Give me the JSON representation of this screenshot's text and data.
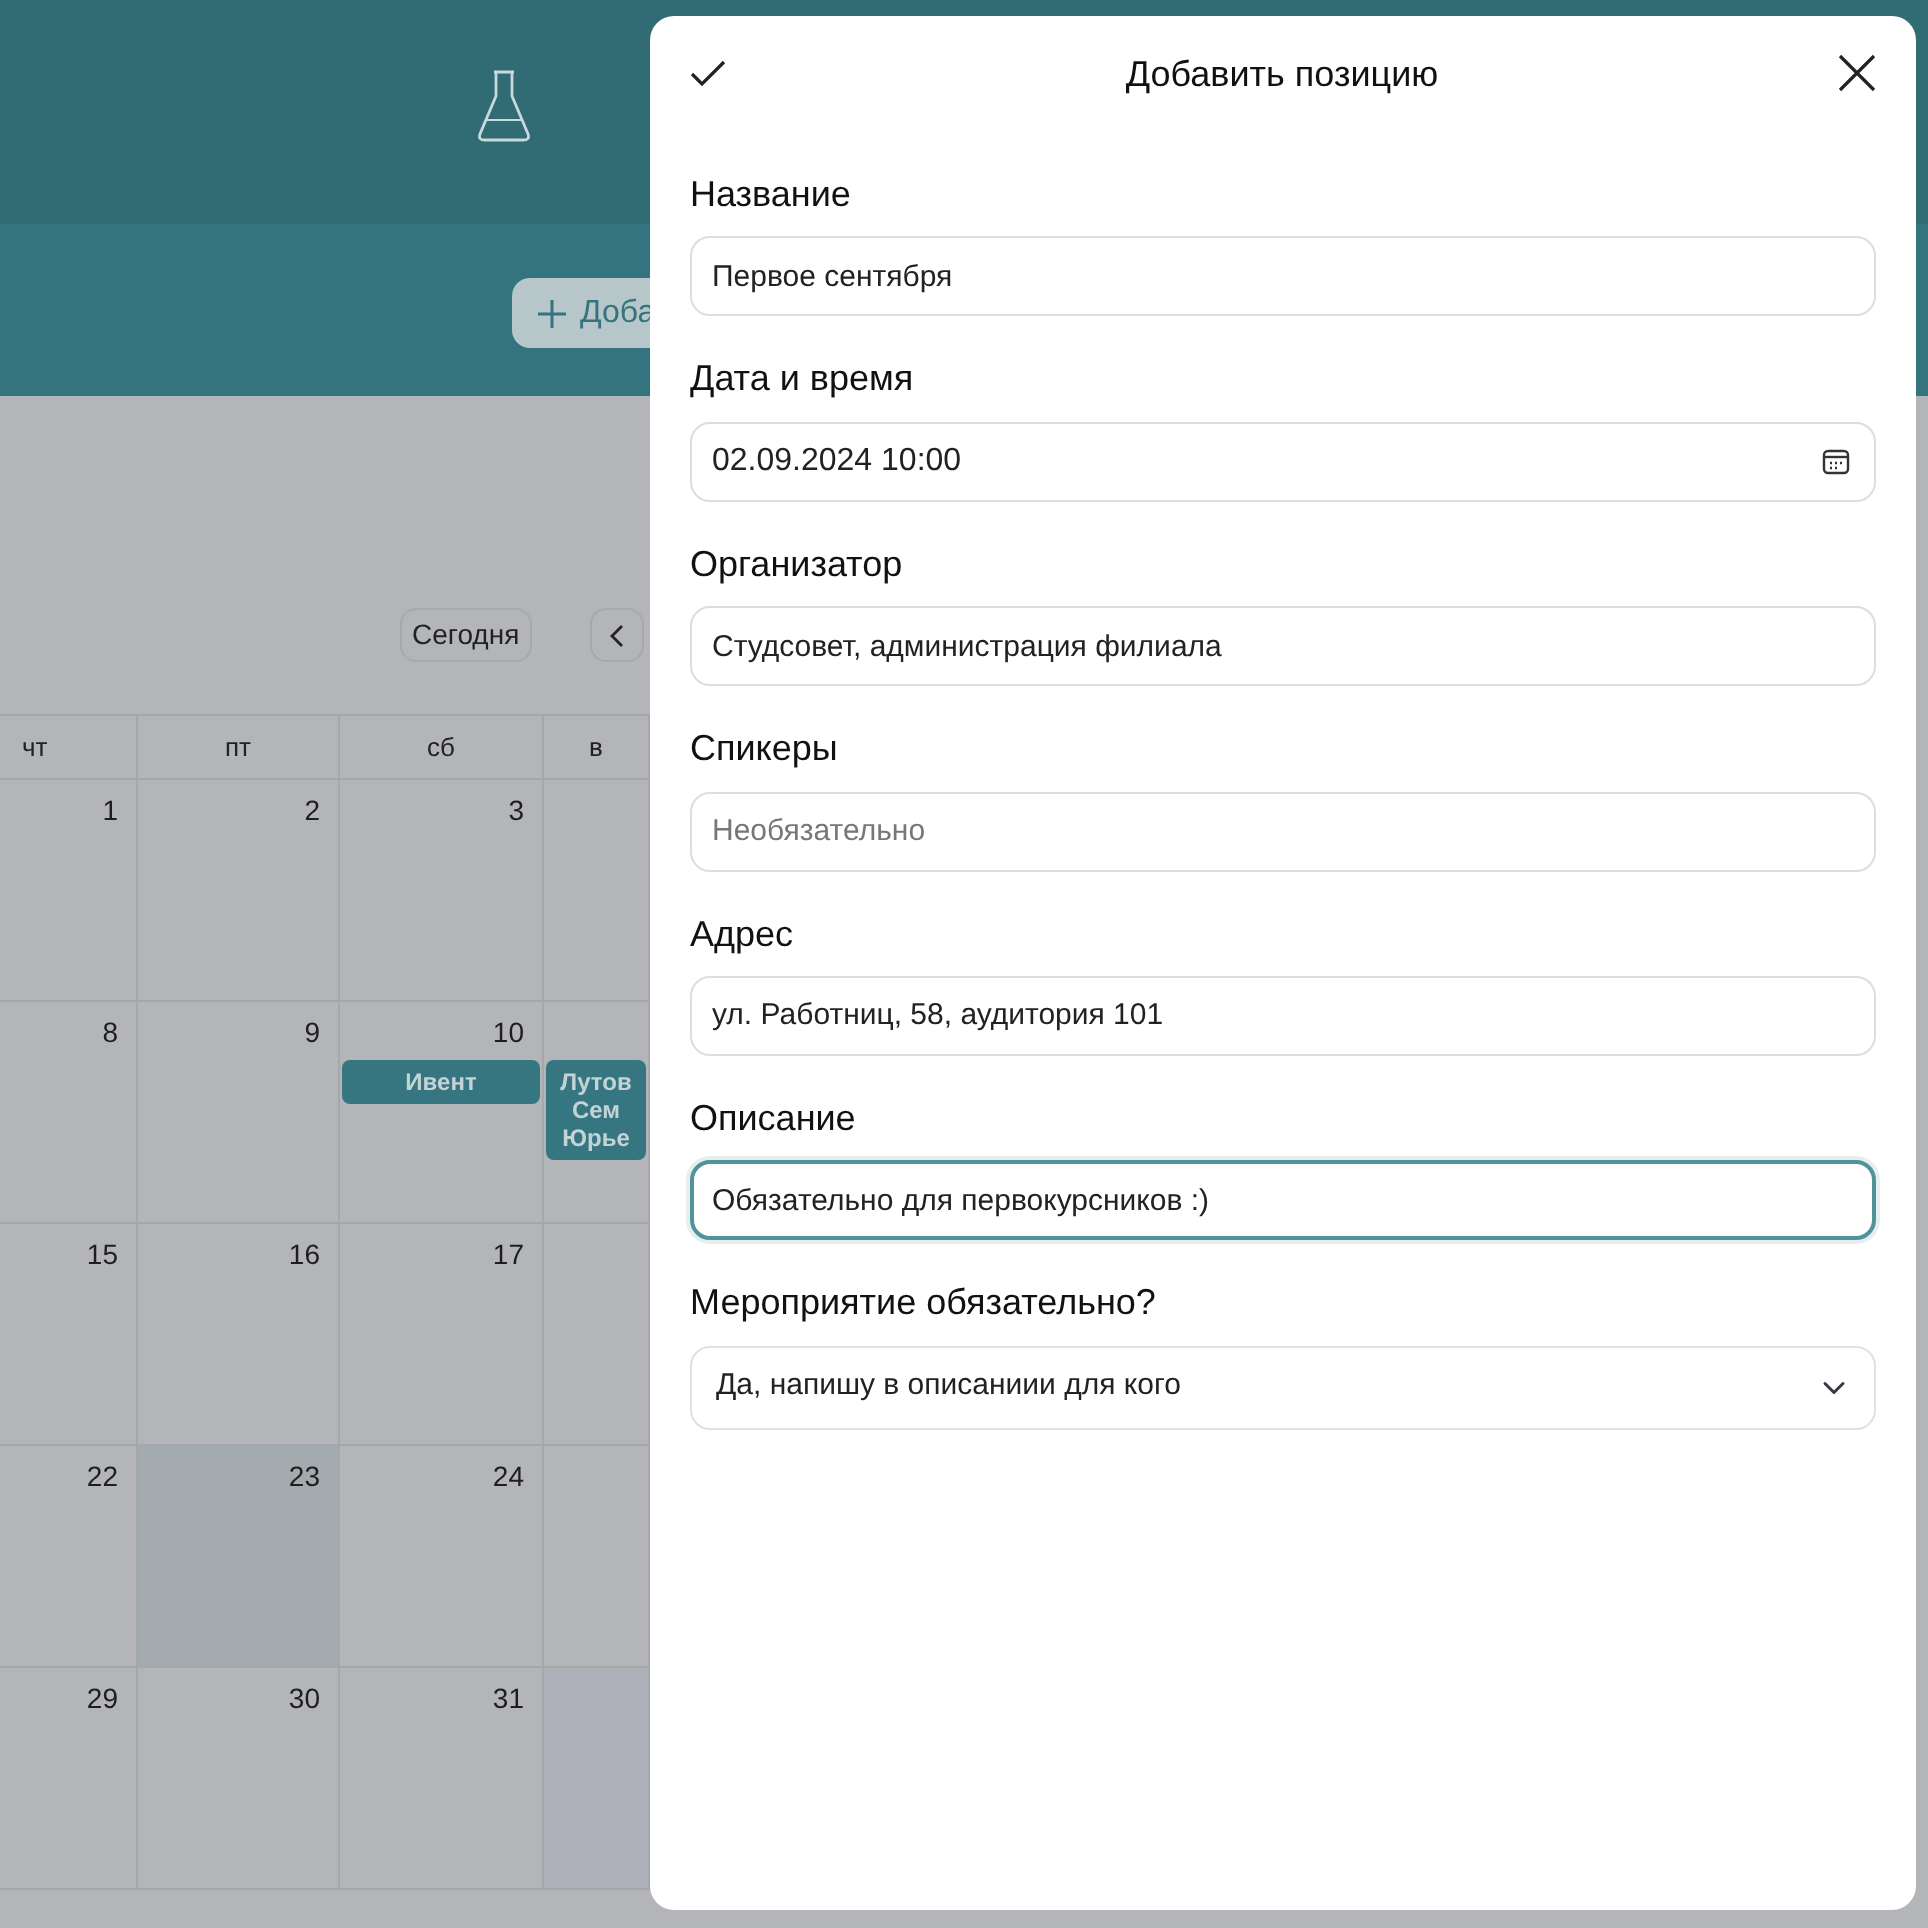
{
  "background": {
    "add_button": {
      "label": "Доба"
    },
    "today_button": {
      "label": "Сегодня"
    },
    "weekdays": [
      "чт",
      "пт",
      "сб",
      "в"
    ],
    "weeks": [
      {
        "days": [
          {
            "number": "1",
            "kind": "normal"
          },
          {
            "number": "2",
            "kind": "normal"
          },
          {
            "number": "3",
            "kind": "normal"
          },
          {
            "kind": "normal"
          }
        ]
      },
      {
        "days": [
          {
            "number": "8",
            "kind": "normal"
          },
          {
            "number": "9",
            "kind": "normal"
          },
          {
            "number": "10",
            "kind": "normal",
            "events": [
              {
                "lines": [
                  "Ивент"
                ]
              }
            ]
          },
          {
            "kind": "normal",
            "events": [
              {
                "lines": [
                  "Лутов",
                  "Сем",
                  "Юрье"
                ]
              }
            ]
          }
        ]
      },
      {
        "days": [
          {
            "number": "15",
            "kind": "normal"
          },
          {
            "number": "16",
            "kind": "normal"
          },
          {
            "number": "17",
            "kind": "normal"
          },
          {
            "kind": "normal"
          }
        ]
      },
      {
        "days": [
          {
            "number": "22",
            "kind": "normal"
          },
          {
            "number": "23",
            "kind": "today"
          },
          {
            "number": "24",
            "kind": "normal"
          },
          {
            "kind": "normal"
          }
        ]
      },
      {
        "days": [
          {
            "number": "29",
            "kind": "normal"
          },
          {
            "number": "30",
            "kind": "normal"
          },
          {
            "number": "31",
            "kind": "normal"
          },
          {
            "kind": "outside"
          }
        ]
      }
    ]
  },
  "dialog": {
    "title": "Добавить позицию",
    "fields": [
      {
        "label": "Название",
        "kind": "text",
        "value": "Первое сентября",
        "focused": false
      },
      {
        "label": "Дата и время",
        "kind": "datetime",
        "value": "02.09.2024 10:00",
        "focused": false
      },
      {
        "label": "Организатор",
        "kind": "text",
        "value": "Студсовет, администрация филиала",
        "focused": false
      },
      {
        "label": "Спикеры",
        "kind": "text",
        "placeholder": "Необязательно",
        "focused": false
      },
      {
        "label": "Адрес",
        "kind": "text",
        "value": "ул. Работниц, 58, аудитория 101",
        "focused": false
      },
      {
        "label": "Описание",
        "kind": "text",
        "value": "Обязательно для первокурсников :)",
        "focused": true
      },
      {
        "label": "Мероприятие обязательно?",
        "kind": "select",
        "value": "Да, напишу в описаниии для кого",
        "focused": false
      }
    ]
  }
}
